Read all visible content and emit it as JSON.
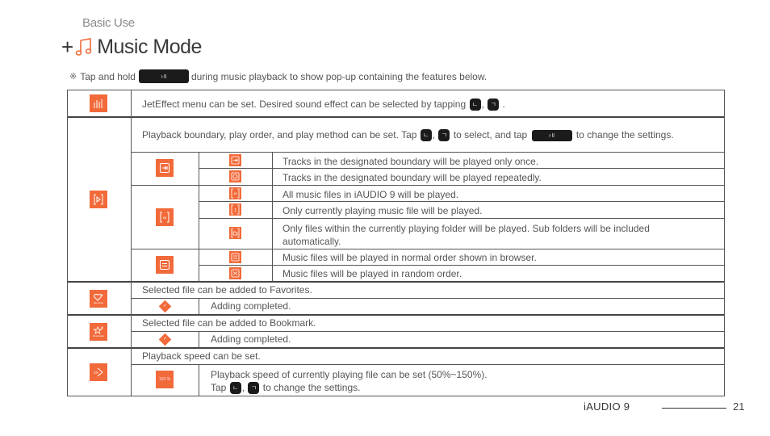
{
  "header": {
    "section": "Basic Use",
    "prefix": "+",
    "title": "Music Mode",
    "title_icon": "music-note-icon",
    "accent_color": "#f26a3a"
  },
  "intro": {
    "reference_mark": "※",
    "before": "Tap and hold",
    "button_glyph": "›॥",
    "after": "during music playback to show pop-up containing the features below."
  },
  "buttons": {
    "left": "ㄴ",
    "right": "ㄱ",
    "play": "›॥"
  },
  "rows": {
    "jeteffect": {
      "icon": "equalizer-icon",
      "text_before": "JetEffect menu can be set. Desired sound effect can be selected by tapping",
      "sep": ",",
      "text_after": "."
    },
    "playback": {
      "icon": "play-mode-icon",
      "text_a": "Playback boundary, play order, and play method can be set. Tap",
      "sep": ",",
      "text_b": "to select, and tap",
      "text_c": "to change the settings.",
      "groups": [
        {
          "icon": "boundary-icon",
          "items": [
            {
              "icon": "play-once-icon",
              "text": "Tracks in the designated boundary will be played only once."
            },
            {
              "icon": "repeat-icon",
              "text": "Tracks in the designated boundary will be played repeatedly."
            }
          ]
        },
        {
          "icon": "scope-all-icon",
          "items": [
            {
              "icon": "all-icon",
              "label": "All",
              "text": "All music files in iAUDIO 9 will be played."
            },
            {
              "icon": "one-icon",
              "label": "1",
              "text": "Only currently playing music file will be played."
            },
            {
              "icon": "folder-icon",
              "text": "Only files within the currently playing folder will be played. Sub folders will be included automatically."
            }
          ]
        },
        {
          "icon": "order-icon",
          "items": [
            {
              "icon": "normal-order-icon",
              "text": "Music files will be played in normal order shown in browser."
            },
            {
              "icon": "shuffle-icon",
              "text": "Music files will be played in random order."
            }
          ]
        }
      ]
    },
    "favorites": {
      "icon": "favorites-icon",
      "icon_label": "Favorites",
      "text": "Selected file can be added to Favorites.",
      "sub_icon": "check-diamond-icon",
      "sub_text": "Adding completed."
    },
    "bookmark": {
      "icon": "bookmark-icon",
      "icon_label": "Bookmark",
      "text": "Selected file can be added to Bookmark.",
      "sub_icon": "check-diamond-icon",
      "sub_text": "Adding completed."
    },
    "speed": {
      "icon": "speed-icon",
      "icon_label": "2X",
      "text": "Playback speed can be set.",
      "sub_icon_label": "150 %",
      "sub_text_1": "Playback speed of currently playing file can be set (50%~150%).",
      "sub_text_2_a": "Tap",
      "sep": ",",
      "sub_text_2_b": "to change the settings."
    }
  },
  "footer": {
    "brand": "iAUDIO 9",
    "page": "21"
  }
}
